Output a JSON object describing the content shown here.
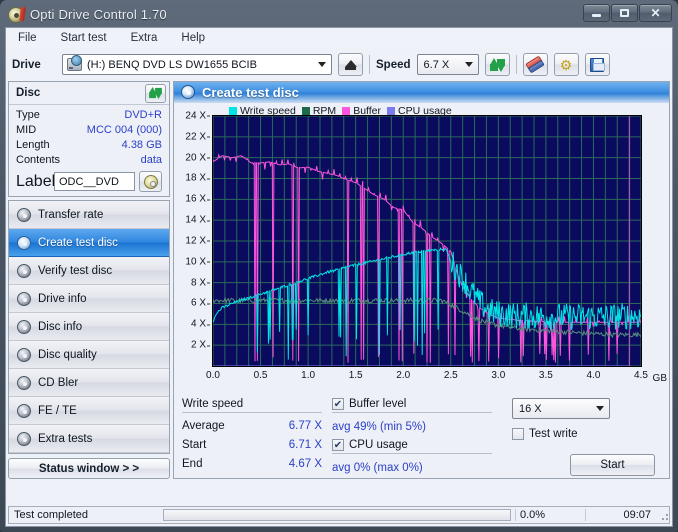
{
  "window": {
    "title": "Opti Drive Control 1.70",
    "icon": "disc-icon",
    "buttons": {
      "minimize": "minimize",
      "maximize": "maximize",
      "close": "close"
    }
  },
  "menu": {
    "items": [
      "File",
      "Start test",
      "Extra",
      "Help"
    ]
  },
  "toolbar": {
    "drive_label": "Drive",
    "drive_value": "(H:)   BENQ DVD LS DW1655 BCIB",
    "eject_label": "eject",
    "speed_label": "Speed",
    "speed_value": "6.7 X",
    "refresh_label": "refresh",
    "eraser_label": "erase",
    "settings_label": "settings",
    "save_label": "save"
  },
  "disc": {
    "header": "Disc",
    "refresh_icon": "refresh-icon",
    "rows": [
      {
        "key": "Type",
        "value": "DVD+R"
      },
      {
        "key": "MID",
        "value": "MCC 004 (000)"
      },
      {
        "key": "Length",
        "value": "4.38 GB"
      },
      {
        "key": "Contents",
        "value": "data"
      }
    ],
    "label_key": "Label",
    "label_value": "ODC__DVD",
    "label_button_icon": "cd-icon"
  },
  "nav": {
    "items": [
      {
        "label": "Transfer rate",
        "active": false
      },
      {
        "label": "Create test disc",
        "active": true
      },
      {
        "label": "Verify test disc",
        "active": false
      },
      {
        "label": "Drive info",
        "active": false
      },
      {
        "label": "Disc info",
        "active": false
      },
      {
        "label": "Disc quality",
        "active": false
      },
      {
        "label": "CD Bler",
        "active": false
      },
      {
        "label": "FE / TE",
        "active": false
      },
      {
        "label": "Extra tests",
        "active": false
      }
    ],
    "status_window": "Status window > >"
  },
  "content": {
    "header_title": "Create test disc",
    "header_icon": "disc-icon"
  },
  "stats": {
    "write_speed_title": "Write speed",
    "rows": [
      {
        "key": "Average",
        "value": "6.77 X"
      },
      {
        "key": "Start",
        "value": "6.71 X"
      },
      {
        "key": "End",
        "value": "4.67 X"
      }
    ],
    "buffer_label": "Buffer level",
    "buffer_checked": true,
    "buffer_value": "avg 49% (min 5%)",
    "cpu_label": "CPU usage",
    "cpu_checked": true,
    "cpu_value": "avg 0% (max 0%)",
    "speed_select": "16 X",
    "test_write_label": "Test write",
    "test_write_checked": false,
    "start_button": "Start"
  },
  "statusbar": {
    "text": "Test completed",
    "progress_percent": "0.0%",
    "progress_value": 0,
    "time": "09:07"
  },
  "chart_data": {
    "type": "line",
    "title": "Create test disc",
    "xlabel": "GB",
    "ylabel": "X",
    "xlim": [
      0.0,
      4.5
    ],
    "ylim": [
      0,
      24
    ],
    "xticks": [
      "0.0",
      "0.5",
      "1.0",
      "1.5",
      "2.0",
      "2.5",
      "3.0",
      "3.5",
      "4.0",
      "4.5"
    ],
    "xtick_values": [
      0.0,
      0.5,
      1.0,
      1.5,
      2.0,
      2.5,
      3.0,
      3.5,
      4.0,
      4.5
    ],
    "yticks": [
      "2 X",
      "4 X",
      "6 X",
      "8 X",
      "10 X",
      "12 X",
      "14 X",
      "16 X",
      "18 X",
      "20 X",
      "22 X",
      "24 X"
    ],
    "ytick_values": [
      2,
      4,
      6,
      8,
      10,
      12,
      14,
      16,
      18,
      20,
      22,
      24
    ],
    "grid": true,
    "plot_background": "#0a0a5e",
    "disc_end_marker_gb": 4.38,
    "disc_end_marker_color": "#c050c0",
    "legend_position": "top-left",
    "legend": [
      {
        "name": "Write speed",
        "color": "#00e5e5"
      },
      {
        "name": "RPM",
        "color": "#1b6b4a"
      },
      {
        "name": "Buffer",
        "color": "#ff55dd"
      },
      {
        "name": "CPU usage",
        "color": "#7b7bf0"
      }
    ],
    "series": [
      {
        "name": "Write speed",
        "color": "#00e5e5",
        "x": [
          0.0,
          0.05,
          0.1,
          0.15,
          0.2,
          0.3,
          0.4,
          0.5,
          0.6,
          0.7,
          0.8,
          0.9,
          1.0,
          1.1,
          1.2,
          1.3,
          1.4,
          1.5,
          1.6,
          1.7,
          1.8,
          1.9,
          2.0,
          2.1,
          2.2,
          2.3,
          2.4,
          2.45,
          2.5,
          2.55,
          2.6,
          2.65,
          2.7,
          2.75,
          2.8,
          2.85,
          2.9,
          2.95,
          3.0,
          3.1,
          3.2,
          3.3,
          3.4,
          3.5,
          3.6,
          3.7,
          3.8,
          3.9,
          4.0,
          4.1,
          4.2,
          4.3,
          4.38
        ],
        "y": [
          4.3,
          5.2,
          5.6,
          5.8,
          6.0,
          6.3,
          6.6,
          6.9,
          7.2,
          7.5,
          7.8,
          8.1,
          8.4,
          8.7,
          9.0,
          9.2,
          9.5,
          9.7,
          9.9,
          10.1,
          10.3,
          10.5,
          10.7,
          10.9,
          11.0,
          11.1,
          11.2,
          11.2,
          10.0,
          9.3,
          8.6,
          8.0,
          7.2,
          6.6,
          6.0,
          5.6,
          5.2,
          5.0,
          4.9,
          4.8,
          4.7,
          4.7,
          4.6,
          4.6,
          4.6,
          4.6,
          4.6,
          4.6,
          4.6,
          4.6,
          4.6,
          4.67,
          4.67
        ]
      },
      {
        "name": "RPM",
        "color": "#1b6b4a",
        "x": [
          0.0,
          0.2,
          0.5,
          1.0,
          1.5,
          2.0,
          2.4,
          2.5,
          2.6,
          2.7,
          2.8,
          2.9,
          3.0,
          3.2,
          3.5,
          3.8,
          4.0,
          4.2,
          4.38
        ],
        "y": [
          6.3,
          6.3,
          6.3,
          6.3,
          6.3,
          6.3,
          6.3,
          5.9,
          5.4,
          4.9,
          4.4,
          4.1,
          3.9,
          3.6,
          3.4,
          3.2,
          3.1,
          3.0,
          3.0
        ]
      },
      {
        "name": "Buffer",
        "color": "#ff55dd",
        "x": [
          0.0,
          0.1,
          0.2,
          0.3,
          0.4,
          0.5,
          0.6,
          0.7,
          0.8,
          0.9,
          1.0,
          1.1,
          1.2,
          1.3,
          1.4,
          1.5,
          1.6,
          1.7,
          1.8,
          1.9,
          2.0,
          2.1,
          2.2,
          2.3,
          2.4,
          2.5,
          2.6,
          2.7,
          2.8,
          2.9,
          3.0,
          3.2,
          3.4,
          3.6,
          3.8,
          4.0,
          4.2,
          4.38
        ],
        "y": [
          19.6,
          20.2,
          20.0,
          20.2,
          19.5,
          19.5,
          19.6,
          19.3,
          19.4,
          19.0,
          19.1,
          18.7,
          18.5,
          18.3,
          17.9,
          17.6,
          17.0,
          16.4,
          16.0,
          15.2,
          15.0,
          13.8,
          13.2,
          12.4,
          11.8,
          11.0,
          8.0,
          6.6,
          5.6,
          5.0,
          4.6,
          4.4,
          4.3,
          4.2,
          4.2,
          4.2,
          4.2,
          4.2
        ]
      },
      {
        "name": "CPU usage",
        "color": "#7b7bf0",
        "x": [
          0.0,
          4.38
        ],
        "y": [
          0.0,
          0.0
        ]
      }
    ],
    "notes": "Write speed rises from ~4.3X at start to ~11.2X peak near 2.45 GB, then drops to ~4.6X for the remainder. Buffer level shows frequent downward spikes toward 0 throughout the recording."
  }
}
